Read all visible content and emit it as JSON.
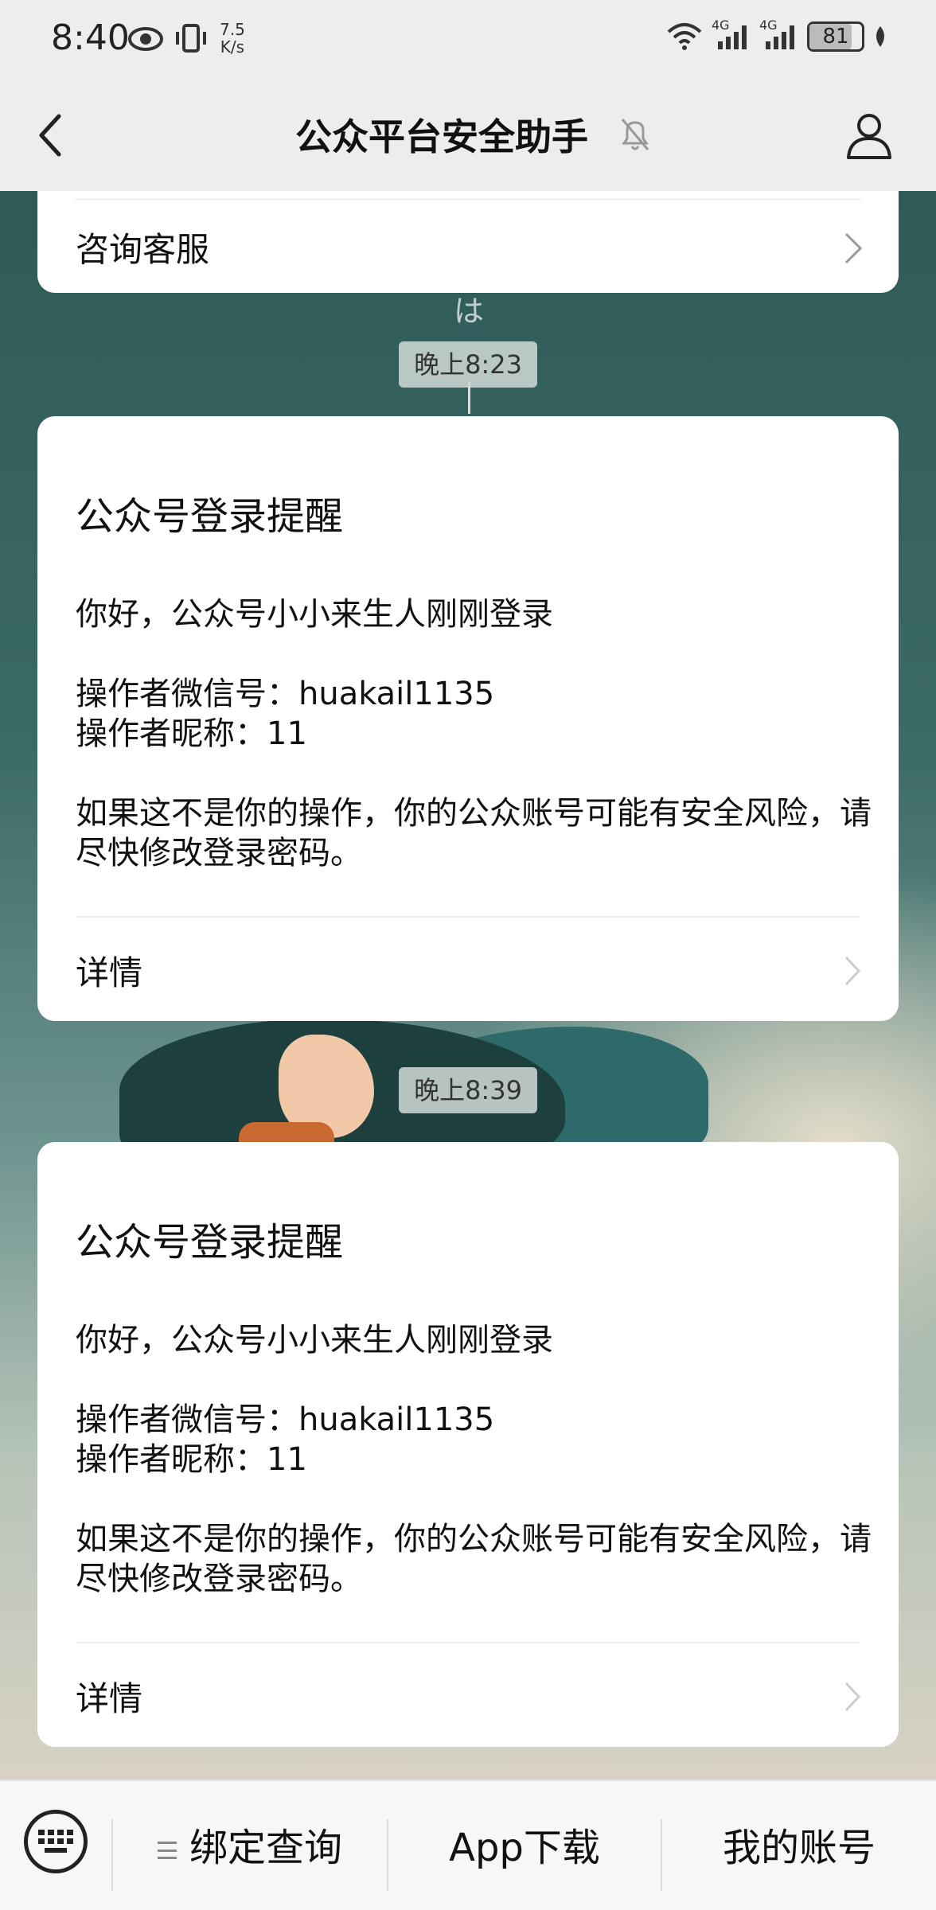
{
  "status_bar": {
    "time": "8:40",
    "speed_value": "7.5",
    "speed_unit": "K/s",
    "network_1": "4G",
    "network_2": "4G",
    "battery": "81"
  },
  "nav": {
    "title": "公众平台安全助手"
  },
  "top_card": {
    "label": "咨询客服"
  },
  "background_text": "は",
  "messages": [
    {
      "time": "晚上8:23",
      "title": "公众号登录提醒",
      "greeting": "你好，公众号小小来生人刚刚登录",
      "operator_id": "操作者微信号：huakail1135",
      "operator_nick": "操作者昵称：11",
      "warning": "如果这不是你的操作，你的公众账号可能有安全风险，请尽快修改登录密码。",
      "detail": "详情"
    },
    {
      "time": "晚上8:39",
      "title": "公众号登录提醒",
      "greeting": "你好，公众号小小来生人刚刚登录",
      "operator_id": "操作者微信号：huakail1135",
      "operator_nick": "操作者昵称：11",
      "warning": "如果这不是你的操作，你的公众账号可能有安全风险，请尽快修改登录密码。",
      "detail": "详情"
    }
  ],
  "bottom_menu": {
    "items": [
      "绑定查询",
      "App下载",
      "我的账号"
    ]
  }
}
